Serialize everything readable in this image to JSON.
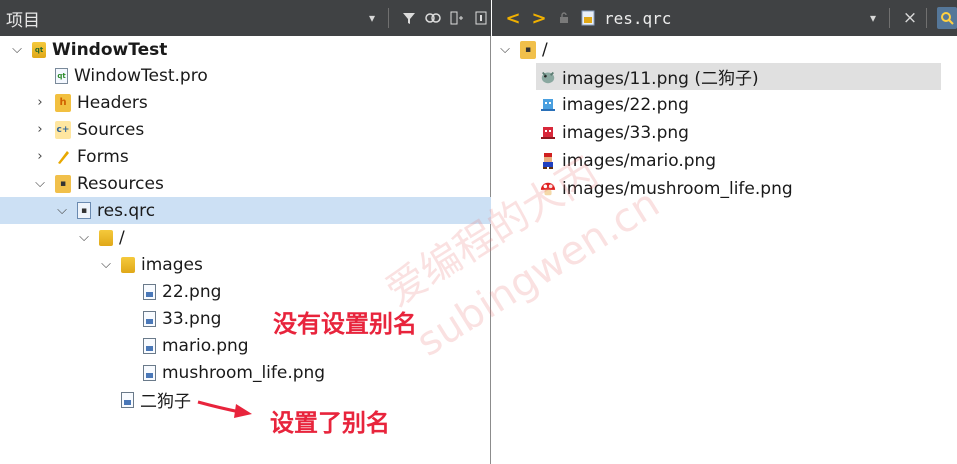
{
  "left_toolbar": {
    "title": "项目",
    "buttons": [
      {
        "name": "filter-dropdown-icon",
        "glyph": "▾"
      },
      {
        "name": "filter-icon",
        "glyph": "⊤"
      },
      {
        "name": "link-icon",
        "glyph": "⊖"
      },
      {
        "name": "split-add-icon",
        "glyph": "⊞"
      },
      {
        "name": "close-pane-icon",
        "glyph": "◫"
      }
    ]
  },
  "right_toolbar": {
    "back_glyph": "<",
    "forward_glyph": ">",
    "file_title": "res.qrc",
    "dropdown_glyph": "▾",
    "close_glyph": "×",
    "locator_glyph": "⚲"
  },
  "project_tree": [
    {
      "label": "WindowTest",
      "icon": "project-folder-icon",
      "chevron": "v",
      "bold": true
    },
    {
      "label": "WindowTest.pro",
      "icon": "pro-file-icon",
      "chevron": ""
    },
    {
      "label": "Headers",
      "icon": "headers-icon",
      "chevron": ">"
    },
    {
      "label": "Sources",
      "icon": "sources-icon",
      "chevron": ">"
    },
    {
      "label": "Forms",
      "icon": "forms-icon",
      "chevron": ">"
    },
    {
      "label": "Resources",
      "icon": "resources-icon",
      "chevron": "v"
    },
    {
      "label": "res.qrc",
      "icon": "qrc-file-icon",
      "chevron": "v",
      "selected": true
    },
    {
      "label": "/",
      "icon": "folder-icon",
      "chevron": "v"
    },
    {
      "label": "images",
      "icon": "folder-icon",
      "chevron": "v"
    },
    {
      "label": "22.png",
      "icon": "image-file-icon",
      "chevron": ""
    },
    {
      "label": "33.png",
      "icon": "image-file-icon",
      "chevron": ""
    },
    {
      "label": "mario.png",
      "icon": "image-file-icon",
      "chevron": ""
    },
    {
      "label": "mushroom_life.png",
      "icon": "image-file-icon",
      "chevron": ""
    },
    {
      "label": "二狗子",
      "icon": "image-file-icon",
      "chevron": ""
    }
  ],
  "resource_tree": [
    {
      "label": "/",
      "icon": "resource-prefix-icon",
      "chevron": "v"
    },
    {
      "label": "images/11.png (二狗子)",
      "icon": "pokemon-icon",
      "selected": true
    },
    {
      "label": "images/22.png",
      "icon": "blue-sprite-icon"
    },
    {
      "label": "images/33.png",
      "icon": "red-sprite-icon"
    },
    {
      "label": "images/mario.png",
      "icon": "mario-icon"
    },
    {
      "label": "images/mushroom_life.png",
      "icon": "mushroom-icon"
    }
  ],
  "annotations": {
    "no_alias": "没有设置别名",
    "has_alias": "设置了别名"
  },
  "watermark": {
    "line1": "爱编程的大丙",
    "line2": "subingwen.cn"
  },
  "colors": {
    "toolbar_bg": "#404244",
    "selection_blue": "#cce0f4",
    "selection_gray": "#e0e0e0",
    "annotation_red": "#e8243c"
  }
}
